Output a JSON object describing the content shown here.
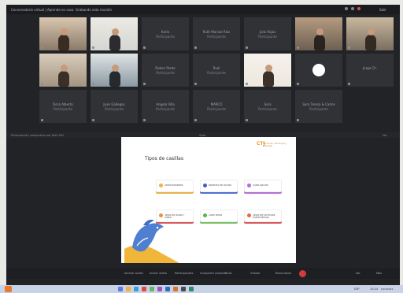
{
  "window": {
    "title_left": "Conversatorio virtual | Aprende en casa",
    "title_mid": "Grabando esta reunión",
    "title_right": "Salir"
  },
  "participants": [
    {
      "type": "video",
      "name": "",
      "sub": ""
    },
    {
      "type": "video",
      "name": "",
      "sub": ""
    },
    {
      "type": "name",
      "name": "Karla",
      "sub": "Participante"
    },
    {
      "type": "name",
      "name": "Ruth Marisol Ríos",
      "sub": "Participante"
    },
    {
      "type": "name",
      "name": "Julio Rojas",
      "sub": "Participante"
    },
    {
      "type": "video",
      "name": "",
      "sub": ""
    },
    {
      "type": "video",
      "name": "",
      "sub": ""
    },
    {
      "type": "video",
      "name": "",
      "sub": ""
    },
    {
      "type": "video",
      "name": "",
      "sub": ""
    },
    {
      "type": "name",
      "name": "Ruben Pardo",
      "sub": "Participante"
    },
    {
      "type": "name",
      "name": "Raúl",
      "sub": "Participante"
    },
    {
      "type": "video",
      "name": "",
      "sub": ""
    },
    {
      "type": "logo",
      "name": "",
      "sub": ""
    },
    {
      "type": "name",
      "name": "Jorge Ch.",
      "sub": ""
    },
    {
      "type": "name",
      "name": "Dora Alberto",
      "sub": "Participante"
    },
    {
      "type": "name",
      "name": "Juan Gallegos",
      "sub": "Participante"
    },
    {
      "type": "name",
      "name": "Angela Villa",
      "sub": "Participante"
    },
    {
      "type": "name",
      "name": "MARCO",
      "sub": "Participante"
    },
    {
      "type": "name",
      "name": "Sara",
      "sub": "Participante"
    },
    {
      "type": "name",
      "name": "Sara Teresa & Carlos",
      "sub": "Participante"
    }
  ],
  "share_bar": {
    "left": "Presentación compartida por Ruth Mili",
    "mid": "Slide",
    "right": "Ver"
  },
  "slide": {
    "logo": "CTJ",
    "brand": "Educación, Tecnología y Liderazgo",
    "title": "Tipos de casillas",
    "boxes": [
      {
        "label": "Seleccionables",
        "dot": "#f0b342",
        "shadow": "sh-orange"
      },
      {
        "label": "Botones de acción",
        "dot": "#3d5fc7",
        "shadow": "sh-blue"
      },
      {
        "label": "Sí/No opción",
        "dot": "#b66dd6",
        "shadow": "sh-purple"
      },
      {
        "label": "Texto de audio / video",
        "dot": "#e59042",
        "shadow": "sh-red"
      },
      {
        "label": "Libre texto",
        "dot": "#5db054",
        "shadow": "sh-green"
      },
      {
        "label": "Texto de fórmulas matemáticas",
        "dot": "#e36b45",
        "shadow": "sh-red"
      }
    ]
  },
  "toolbar": {
    "items": [
      "Activar audio",
      "Iniciar vídeo",
      "Participantes",
      "Compartir pantalla",
      "Chat",
      "Grabar",
      "Reacciones"
    ],
    "leave": "",
    "right_items": [
      "Ver",
      "Más"
    ]
  },
  "taskbar": {
    "time": "10:24",
    "date": "9/03/2021",
    "lang": "ESP"
  },
  "colors": {
    "accent_red": "#d13b3b",
    "screen_bg": "#222326"
  }
}
